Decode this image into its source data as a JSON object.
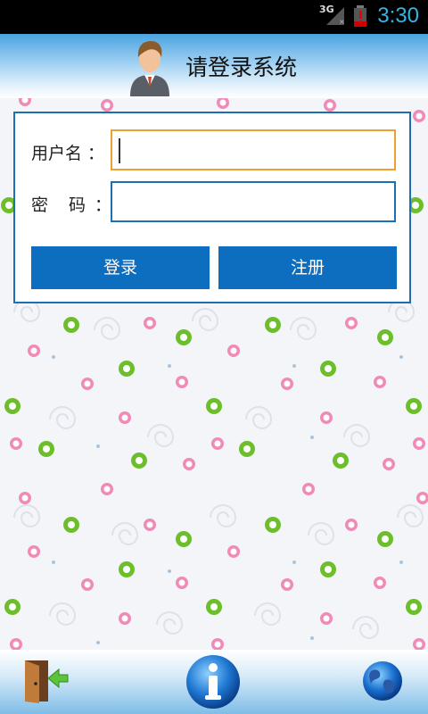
{
  "status_bar": {
    "network": "3G",
    "time": "3:30"
  },
  "header": {
    "title": "请登录系统",
    "avatar_icon": "user-avatar-icon"
  },
  "login_form": {
    "username_label": "用户名 ：",
    "username_value": "",
    "password_label": "密　码 ：",
    "password_value": "",
    "login_button": "登录",
    "register_button": "注册"
  },
  "bottom_bar": {
    "exit_icon": "exit-door-icon",
    "info_icon": "info-icon",
    "globe_icon": "globe-icon"
  },
  "colors": {
    "accent": "#0d6dbf",
    "focus_border": "#f0a030",
    "status_time": "#33b5e5"
  }
}
